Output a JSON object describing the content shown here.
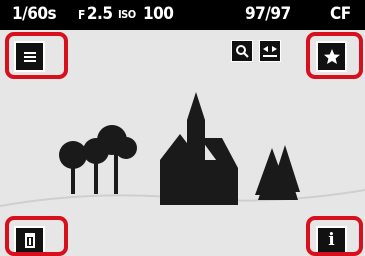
{
  "status_bar": {
    "shutter_speed": "1/60s",
    "aperture_prefix": "F",
    "aperture_value": "2.5",
    "iso_label": "ISO",
    "iso_value": "100",
    "image_counter": "97/97",
    "storage": "CF"
  },
  "icons": {
    "menu": "menu-icon",
    "zoom": "zoom-icon",
    "play": "play-icon",
    "favorite": "star-icon",
    "delete": "trash-icon",
    "info": "info-icon"
  },
  "colors": {
    "status_bar_background": "#000000",
    "preview_background": "#e6e6e6",
    "silhouette": "#1a1a1a",
    "highlight": "#d8101e"
  },
  "info_button_glyph": "i"
}
